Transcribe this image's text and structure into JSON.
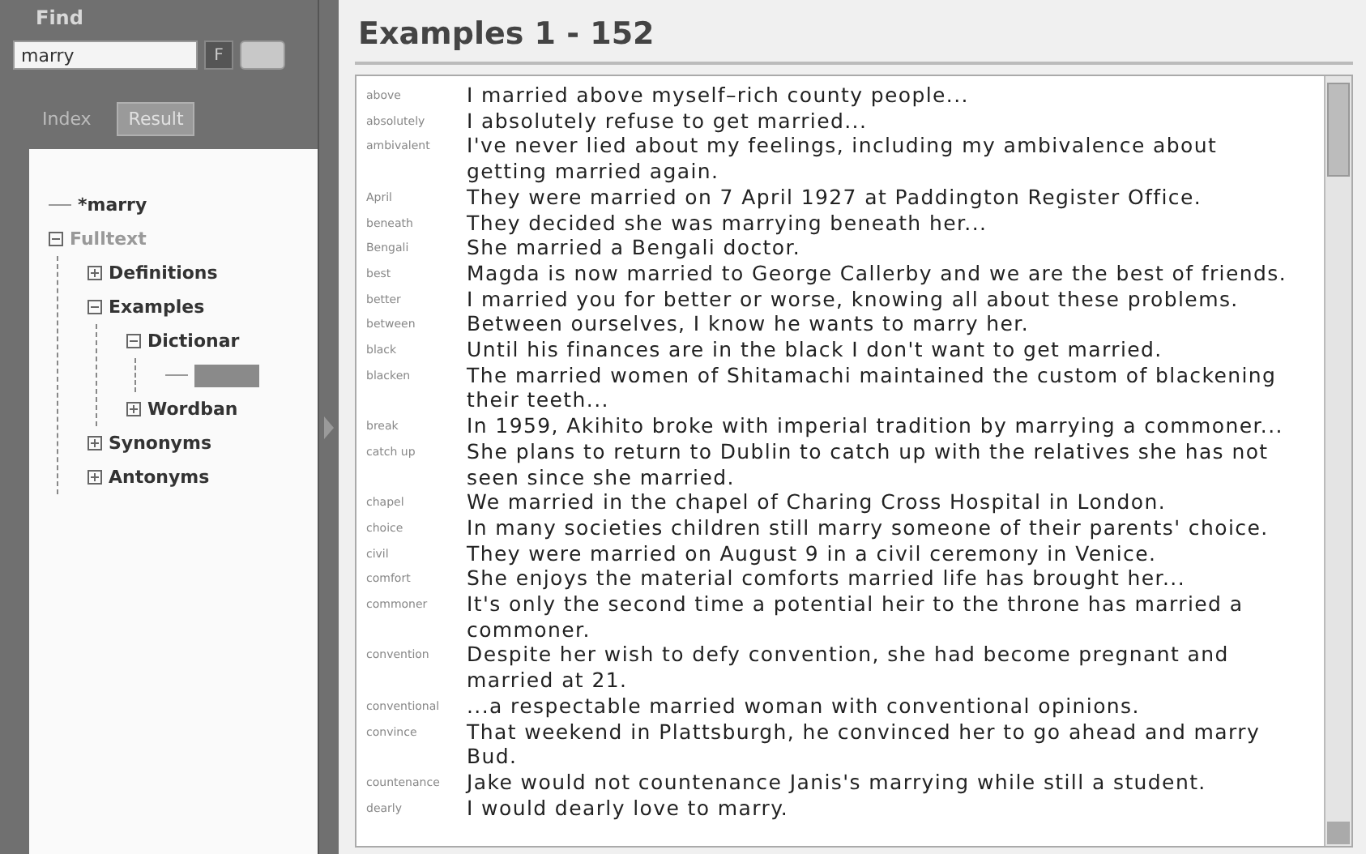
{
  "sidebar": {
    "title": "Find",
    "search": {
      "value": "marry"
    },
    "filter_button": "F",
    "tabs": [
      {
        "label": "Index",
        "selected": false
      },
      {
        "label": "Result",
        "selected": true
      }
    ],
    "tree": [
      {
        "label": "*marry",
        "kind": "leaf",
        "dim": false
      },
      {
        "label": "Fulltext",
        "kind": "node",
        "expanded": true,
        "dim": true,
        "children": [
          {
            "label": "Definitions",
            "kind": "node",
            "expanded": false,
            "dim": false
          },
          {
            "label": "Examples",
            "kind": "node",
            "expanded": true,
            "dim": false,
            "children": [
              {
                "label": "Dictionar",
                "kind": "node",
                "expanded": true,
                "dim": false,
                "children": [
                  {
                    "kind": "selection",
                    "selected": true
                  }
                ]
              },
              {
                "label": "Wordban",
                "kind": "node",
                "expanded": false,
                "dim": false
              }
            ]
          },
          {
            "label": "Synonyms",
            "kind": "node",
            "expanded": false,
            "dim": false
          },
          {
            "label": "Antonyms",
            "kind": "node",
            "expanded": false,
            "dim": false
          }
        ]
      }
    ]
  },
  "main": {
    "heading": "Examples 1 - 152",
    "examples": [
      {
        "word": "above",
        "text": "I married above myself–rich county people..."
      },
      {
        "word": "absolutely",
        "text": "I absolutely refuse to get married..."
      },
      {
        "word": "ambivalent",
        "text": "I've never lied about my feelings, including my ambivalence about getting married again."
      },
      {
        "word": "April",
        "text": "They were married on 7 April 1927 at Paddington Register Office."
      },
      {
        "word": "beneath",
        "text": "They decided she was marrying beneath her..."
      },
      {
        "word": "Bengali",
        "text": "She married a Bengali doctor."
      },
      {
        "word": "best",
        "text": "Magda is now married to George Callerby and we are the best of friends."
      },
      {
        "word": "better",
        "text": "I married you for better or worse, knowing all about these problems."
      },
      {
        "word": "between",
        "text": "Between ourselves, I know he wants to marry her."
      },
      {
        "word": "black",
        "text": "Until his finances are in the black I don't want to get married."
      },
      {
        "word": "blacken",
        "text": "The married women of Shitamachi maintained the custom of blackening their teeth..."
      },
      {
        "word": "break",
        "text": "In 1959, Akihito broke with imperial tradition by marrying a commoner..."
      },
      {
        "word": "catch up",
        "text": "She plans to return to Dublin to catch up with the relatives she has not seen since she married."
      },
      {
        "word": "chapel",
        "text": "We married in the chapel of Charing Cross Hospital in London."
      },
      {
        "word": "choice",
        "text": "In many societies children still marry someone of their parents' choice."
      },
      {
        "word": "civil",
        "text": "They were married on August 9 in a civil ceremony in Venice."
      },
      {
        "word": "comfort",
        "text": "She enjoys the material comforts married life has brought her..."
      },
      {
        "word": "commoner",
        "text": "It's only the second time a potential heir to the throne has married a commoner."
      },
      {
        "word": "convention",
        "text": "Despite her wish to defy convention, she had become pregnant and married at 21."
      },
      {
        "word": "conventional",
        "text": "...a respectable married woman with conventional opinions."
      },
      {
        "word": "convince",
        "text": "That weekend in Plattsburgh, he convinced her to go ahead and marry Bud."
      },
      {
        "word": "countenance",
        "text": "Jake would not countenance Janis's marrying while still a student."
      },
      {
        "word": "dearly",
        "text": "I would dearly love to marry."
      }
    ]
  }
}
